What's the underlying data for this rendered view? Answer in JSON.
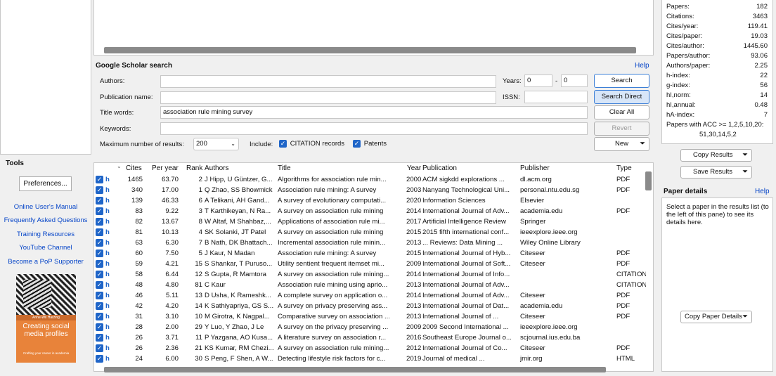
{
  "tools": {
    "title": "Tools",
    "preferences": "Preferences...",
    "links": [
      "Online User's Manual",
      "Frequently Asked Questions",
      "Training Resources",
      "YouTube Channel",
      "Become a PoP Supporter"
    ],
    "book": {
      "author": "Anne-Wil Harzing",
      "title": "Creating social media profiles",
      "subtitle": "Crafting your career in academia"
    }
  },
  "search": {
    "title": "Google Scholar search",
    "help": "Help",
    "authors_label": "Authors:",
    "authors_value": "",
    "publication_label": "Publication name:",
    "publication_value": "",
    "title_words_label": "Title words:",
    "title_words_value": "association rule mining survey",
    "keywords_label": "Keywords:",
    "keywords_value": "",
    "years_label": "Years:",
    "year_from": "0",
    "year_sep": "-",
    "year_to": "0",
    "issn_label": "ISSN:",
    "issn_value": "",
    "max_results_label": "Maximum number of results:",
    "max_results_value": "200",
    "include_label": "Include:",
    "citation_records_label": "CITATION records",
    "patents_label": "Patents",
    "buttons": {
      "search": "Search",
      "search_direct": "Search Direct",
      "clear_all": "Clear All",
      "revert": "Revert",
      "new": "New"
    }
  },
  "results": {
    "columns": [
      "Cites",
      "Per year",
      "Rank",
      "Authors",
      "Title",
      "Year",
      "Publication",
      "Publisher",
      "Type"
    ],
    "rows": [
      {
        "cites": "1465",
        "per_year": "63.70",
        "rank": "2",
        "authors": "J Hipp, U Güntzer, G...",
        "title": "Algorithms for association rule min...",
        "year": "2000",
        "publication": "ACM sigkdd explorations ...",
        "publisher": "dl.acm.org",
        "type": "PDF"
      },
      {
        "cites": "340",
        "per_year": "17.00",
        "rank": "1",
        "authors": "Q Zhao, SS Bhowmick",
        "title": "Association rule mining: A survey",
        "year": "2003",
        "publication": "Nanyang Technological Uni...",
        "publisher": "personal.ntu.edu.sg",
        "type": "PDF"
      },
      {
        "cites": "139",
        "per_year": "46.33",
        "rank": "6",
        "authors": "A Telikani, AH Gand...",
        "title": "A survey of evolutionary computati...",
        "year": "2020",
        "publication": "Information Sciences",
        "publisher": "Elsevier",
        "type": ""
      },
      {
        "cites": "83",
        "per_year": "9.22",
        "rank": "3",
        "authors": "T Karthikeyan, N Ra...",
        "title": "A survey on association rule mining",
        "year": "2014",
        "publication": "International Journal of Adv...",
        "publisher": "academia.edu",
        "type": "PDF"
      },
      {
        "cites": "82",
        "per_year": "13.67",
        "rank": "8",
        "authors": "W Altaf, M Shahbaz,...",
        "title": "Applications of association rule mi...",
        "year": "2017",
        "publication": "Artificial Intelligence Review",
        "publisher": "Springer",
        "type": ""
      },
      {
        "cites": "81",
        "per_year": "10.13",
        "rank": "4",
        "authors": "SK Solanki, JT Patel",
        "title": "A survey on association rule mining",
        "year": "2015",
        "publication": "2015 fifth international conf...",
        "publisher": "ieeexplore.ieee.org",
        "type": ""
      },
      {
        "cites": "63",
        "per_year": "6.30",
        "rank": "7",
        "authors": "B Nath, DK Bhattach...",
        "title": "Incremental association rule minin...",
        "year": "2013",
        "publication": "... Reviews: Data Mining ...",
        "publisher": "Wiley Online Library",
        "type": ""
      },
      {
        "cites": "60",
        "per_year": "7.50",
        "rank": "5",
        "authors": "J Kaur, N Madan",
        "title": "Association rule mining: A survey",
        "year": "2015",
        "publication": "International Journal of Hyb...",
        "publisher": "Citeseer",
        "type": "PDF"
      },
      {
        "cites": "59",
        "per_year": "4.21",
        "rank": "15",
        "authors": "S Shankar, T Puruso...",
        "title": "Utility sentient frequent itemset mi...",
        "year": "2009",
        "publication": "International Journal of Soft...",
        "publisher": "Citeseer",
        "type": "PDF"
      },
      {
        "cites": "58",
        "per_year": "6.44",
        "rank": "12",
        "authors": "S Gupta, R Mamtora",
        "title": "A survey on association rule mining...",
        "year": "2014",
        "publication": "International Journal of Info...",
        "publisher": "",
        "type": "CITATION"
      },
      {
        "cites": "48",
        "per_year": "4.80",
        "rank": "81",
        "authors": "C Kaur",
        "title": "Association rule mining using aprio...",
        "year": "2013",
        "publication": "International Journal of Adv...",
        "publisher": "",
        "type": "CITATION"
      },
      {
        "cites": "46",
        "per_year": "5.11",
        "rank": "13",
        "authors": "D Usha, K Rameshk...",
        "title": "A complete survey on application o...",
        "year": "2014",
        "publication": "International Journal of Adv...",
        "publisher": "Citeseer",
        "type": "PDF"
      },
      {
        "cites": "42",
        "per_year": "4.20",
        "rank": "14",
        "authors": "K Sathiyapriya, GS S...",
        "title": "A survey on privacy preserving ass...",
        "year": "2013",
        "publication": "International Journal of Dat...",
        "publisher": "academia.edu",
        "type": "PDF"
      },
      {
        "cites": "31",
        "per_year": "3.10",
        "rank": "10",
        "authors": "M Girotra, K Nagpal...",
        "title": "Comparative survey on association ...",
        "year": "2013",
        "publication": "International Journal of ...",
        "publisher": "Citeseer",
        "type": "PDF"
      },
      {
        "cites": "28",
        "per_year": "2.00",
        "rank": "29",
        "authors": "Y Luo, Y Zhao, J Le",
        "title": "A survey on the privacy preserving ...",
        "year": "2009",
        "publication": "2009 Second International ...",
        "publisher": "ieeexplore.ieee.org",
        "type": ""
      },
      {
        "cites": "26",
        "per_year": "3.71",
        "rank": "11",
        "authors": "P Yazgana, AO Kusa...",
        "title": "A literature survey on association r...",
        "year": "2016",
        "publication": "Southeast Europe Journal o...",
        "publisher": "scjournal.ius.edu.ba",
        "type": ""
      },
      {
        "cites": "26",
        "per_year": "2.36",
        "rank": "21",
        "authors": "KS Kumar, RM Chezi...",
        "title": "A survey on association rule mining...",
        "year": "2012",
        "publication": "International Journal of Co...",
        "publisher": "Citeseer",
        "type": "PDF"
      },
      {
        "cites": "24",
        "per_year": "6.00",
        "rank": "30",
        "authors": "S Peng, F Shen, A W...",
        "title": "Detecting lifestyle risk factors for c...",
        "year": "2019",
        "publication": "Journal of medical ...",
        "publisher": "jmir.org",
        "type": "HTML"
      }
    ]
  },
  "metrics": [
    {
      "label": "Papers:",
      "value": "182"
    },
    {
      "label": "Citations:",
      "value": "3463"
    },
    {
      "label": "Cites/year:",
      "value": "119.41"
    },
    {
      "label": "Cites/paper:",
      "value": "19.03"
    },
    {
      "label": "Cites/author:",
      "value": "1445.60"
    },
    {
      "label": "Papers/author:",
      "value": "93.06"
    },
    {
      "label": "Authors/paper:",
      "value": "2.25"
    },
    {
      "label": "h-index:",
      "value": "22"
    },
    {
      "label": "g-index:",
      "value": "56"
    },
    {
      "label": "hI,norm:",
      "value": "14"
    },
    {
      "label": "hI,annual:",
      "value": "0.48"
    },
    {
      "label": "hA-index:",
      "value": "7"
    }
  ],
  "acc": {
    "label": "Papers with ACC >= 1,2,5,10,20:",
    "values": "51,30,14,5,2"
  },
  "right_buttons": {
    "copy_results": "Copy Results",
    "save_results": "Save Results",
    "copy_paper_details": "Copy Paper Details"
  },
  "paper_details": {
    "title": "Paper details",
    "help": "Help",
    "text": "Select a paper in the results list (to the left of this pane) to see its details here."
  },
  "colors": {
    "accent": "#1f65c8",
    "link": "#0645c8",
    "book": "#e8833a"
  }
}
